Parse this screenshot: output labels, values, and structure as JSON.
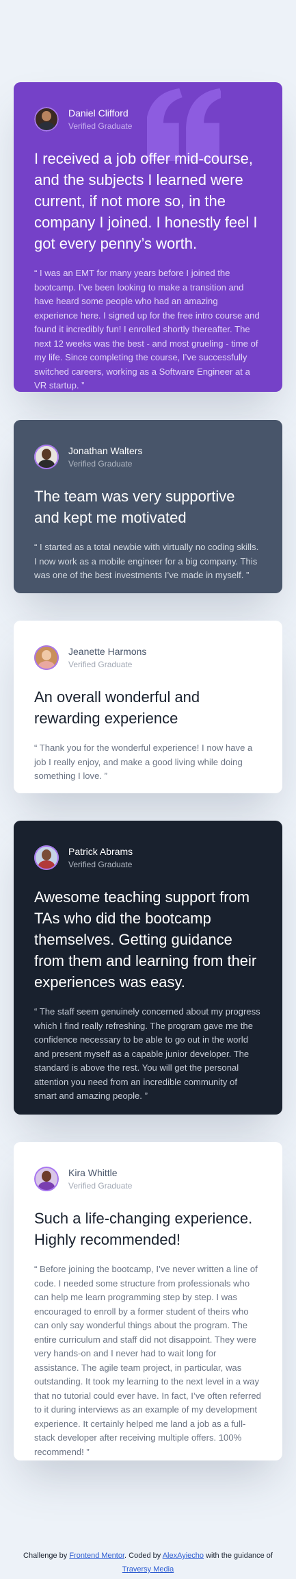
{
  "testimonials": [
    {
      "name": "Daniel Clifford",
      "role": "Verified Graduate",
      "headline": "I received a job offer mid-course, and the subjects I learned were current, if not more so, in the company I joined. I honestly feel I got every penny’s worth.",
      "body": "“ I was an EMT for many years before I joined the bootcamp. I’ve been looking to make a transition and have heard some people who had an amazing experience here. I signed up for the free intro course and found it incredibly fun! I enrolled shortly thereafter. The next 12 weeks was the best - and most grueling - time of my life. Since completing the course, I’ve successfully switched careers, working as a Software Engineer at a VR startup. ”",
      "card_color": "#7541c8"
    },
    {
      "name": "Jonathan Walters",
      "role": "Verified Graduate",
      "headline": "The team was very supportive and kept me motivated",
      "body": "“ I started as a total newbie with virtually no coding skills. I now work as a mobile engineer for a big company. This was one of the best investments I’ve made in myself. ”",
      "card_color": "#48556a"
    },
    {
      "name": "Jeanette Harmons",
      "role": "Verified Graduate",
      "headline": "An overall wonderful and rewarding experience",
      "body": "“ Thank you for the wonderful experience! I now have a job I really enjoy, and make a good living while doing something I love. ”",
      "card_color": "#ffffff"
    },
    {
      "name": "Patrick Abrams",
      "role": "Verified Graduate",
      "headline": "Awesome teaching support from TAs who did the bootcamp themselves. Getting guidance from them and learning from their experiences was easy.",
      "body": "“ The staff seem genuinely concerned about my progress which I find really refreshing. The program gave me the confidence necessary to be able to go out in the world and present myself as a capable junior developer. The standard is above the rest. You will get the personal attention you need from an incredible community of smart and amazing people. ”",
      "card_color": "#19212e"
    },
    {
      "name": "Kira Whittle",
      "role": "Verified Graduate",
      "headline": "Such a life-changing experience. Highly recommended!",
      "body": "“ Before joining the bootcamp, I’ve never written a line of code. I needed some structure from professionals who can help me learn programming step by step. I was encouraged to enroll by a former student of theirs who can only say wonderful things about the program. The entire curriculum and staff did not disappoint. They were very hands-on and I never had to wait long for assistance. The agile team project, in particular, was outstanding. It took my learning to the next level in a way that no tutorial could ever have. In fact, I’ve often referred to it during interviews as an example of my development experience. It certainly helped me land a job as a full-stack developer after receiving multiple offers. 100% recommend! ”",
      "card_color": "#ffffff"
    }
  ],
  "footer": {
    "prefix": "Challenge by",
    "link1": "Frontend Mentor",
    "middle": ". Coded by",
    "link2": "AlexAyiecho",
    "suffix": "with the guidance of",
    "link3": "Traversy Media"
  },
  "icons": {
    "quote": "quotation-mark-icon",
    "avatar": "avatar-photo"
  },
  "colors": {
    "background": "#edf2f8",
    "accent": "#a775f1",
    "link": "#2b5bd1"
  }
}
